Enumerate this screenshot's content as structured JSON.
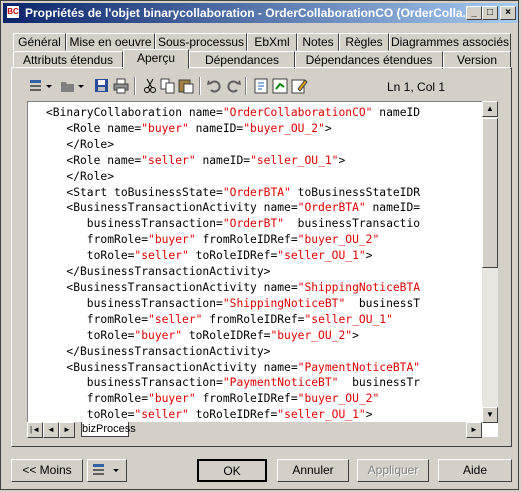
{
  "window": {
    "title": "Propriétés de l'objet binarycollaboration - OrderCollaborationCO (OrderColla...",
    "app_icon_text": "BC",
    "controls": [
      "minimize",
      "maximize",
      "close"
    ]
  },
  "tabs_row1": [
    "Général",
    "Mise en oeuvre",
    "Sous-processus",
    "EbXml",
    "Notes",
    "Règles",
    "Diagrammes associés"
  ],
  "tabs_row2": [
    "Attributs étendus",
    "Aperçu",
    "Dépendances",
    "Dépendances étendues",
    "Version"
  ],
  "active_tab": "Aperçu",
  "toolbar": {
    "icons": [
      "properties-icon",
      "dropdown-arrow-icon",
      "open-icon",
      "dropdown-arrow-icon",
      "save-icon",
      "print-icon",
      "cut-icon",
      "copy-icon",
      "paste-icon",
      "undo-icon",
      "redo-icon",
      "refresh-icon",
      "export-icon",
      "edit-icon"
    ],
    "position": "Ln 1, Col 1"
  },
  "code_lines": [
    [
      {
        "t": "<BinaryCollaboration name="
      },
      {
        "t": "\"OrderCollaborationCO\"",
        "v": 1
      },
      {
        "t": " nameID"
      }
    ],
    [
      {
        "t": "   <Role name="
      },
      {
        "t": "\"buyer\"",
        "v": 1
      },
      {
        "t": " nameID="
      },
      {
        "t": "\"buyer_OU_2\"",
        "v": 1
      },
      {
        "t": ">"
      }
    ],
    [
      {
        "t": "   </Role>"
      }
    ],
    [
      {
        "t": "   <Role name="
      },
      {
        "t": "\"seller\"",
        "v": 1
      },
      {
        "t": " nameID="
      },
      {
        "t": "\"seller_OU_1\"",
        "v": 1
      },
      {
        "t": ">"
      }
    ],
    [
      {
        "t": "   </Role>"
      }
    ],
    [
      {
        "t": "   <Start toBusinessState="
      },
      {
        "t": "\"OrderBTA\"",
        "v": 1
      },
      {
        "t": " toBusinessStateIDR"
      }
    ],
    [
      {
        "t": "   <BusinessTransactionActivity name="
      },
      {
        "t": "\"OrderBTA\"",
        "v": 1
      },
      {
        "t": " nameID="
      }
    ],
    [
      {
        "t": "      businessTransaction="
      },
      {
        "t": "\"OrderBT\"",
        "v": 1
      },
      {
        "t": "  businessTransactio"
      }
    ],
    [
      {
        "t": "      fromRole="
      },
      {
        "t": "\"buyer\"",
        "v": 1
      },
      {
        "t": " fromRoleIDRef="
      },
      {
        "t": "\"buyer_OU_2\"",
        "v": 1
      }
    ],
    [
      {
        "t": "      toRole="
      },
      {
        "t": "\"seller\"",
        "v": 1
      },
      {
        "t": " toRoleIDRef="
      },
      {
        "t": "\"seller_OU_1\"",
        "v": 1
      },
      {
        "t": ">"
      }
    ],
    [
      {
        "t": "   </BusinessTransactionActivity>"
      }
    ],
    [
      {
        "t": "   <BusinessTransactionActivity name="
      },
      {
        "t": "\"ShippingNoticeBTA",
        "v": 1
      }
    ],
    [
      {
        "t": "      businessTransaction="
      },
      {
        "t": "\"ShippingNoticeBT\"",
        "v": 1
      },
      {
        "t": "  businessT"
      }
    ],
    [
      {
        "t": "      fromRole="
      },
      {
        "t": "\"seller\"",
        "v": 1
      },
      {
        "t": " fromRoleIDRef="
      },
      {
        "t": "\"seller_OU_1\"",
        "v": 1
      }
    ],
    [
      {
        "t": "      toRole="
      },
      {
        "t": "\"buyer\"",
        "v": 1
      },
      {
        "t": " toRoleIDRef="
      },
      {
        "t": "\"buyer_OU_2\"",
        "v": 1
      },
      {
        "t": ">"
      }
    ],
    [
      {
        "t": "   </BusinessTransactionActivity>"
      }
    ],
    [
      {
        "t": "   <BusinessTransactionActivity name="
      },
      {
        "t": "\"PaymentNoticeBTA\"",
        "v": 1
      }
    ],
    [
      {
        "t": "      businessTransaction="
      },
      {
        "t": "\"PaymentNoticeBT\"",
        "v": 1
      },
      {
        "t": "  businessTr"
      }
    ],
    [
      {
        "t": "      fromRole="
      },
      {
        "t": "\"buyer\"",
        "v": 1
      },
      {
        "t": " fromRoleIDRef="
      },
      {
        "t": "\"buyer_OU_2\"",
        "v": 1
      }
    ],
    [
      {
        "t": "      toRole="
      },
      {
        "t": "\"seller\"",
        "v": 1
      },
      {
        "t": " toRoleIDRef="
      },
      {
        "t": "\"seller_OU_1\"",
        "v": 1
      },
      {
        "t": ">"
      }
    ]
  ],
  "bottom_tab": "bizProcess",
  "buttons": {
    "less": "<< Moins",
    "ok": "OK",
    "cancel": "Annuler",
    "apply": "Appliquer",
    "help": "Aide"
  },
  "colors": {
    "title_gradient_start": "#0a246a",
    "title_gradient_end": "#a6caf0",
    "code_value": "#e00000",
    "window_bg": "#d4d0c8"
  }
}
